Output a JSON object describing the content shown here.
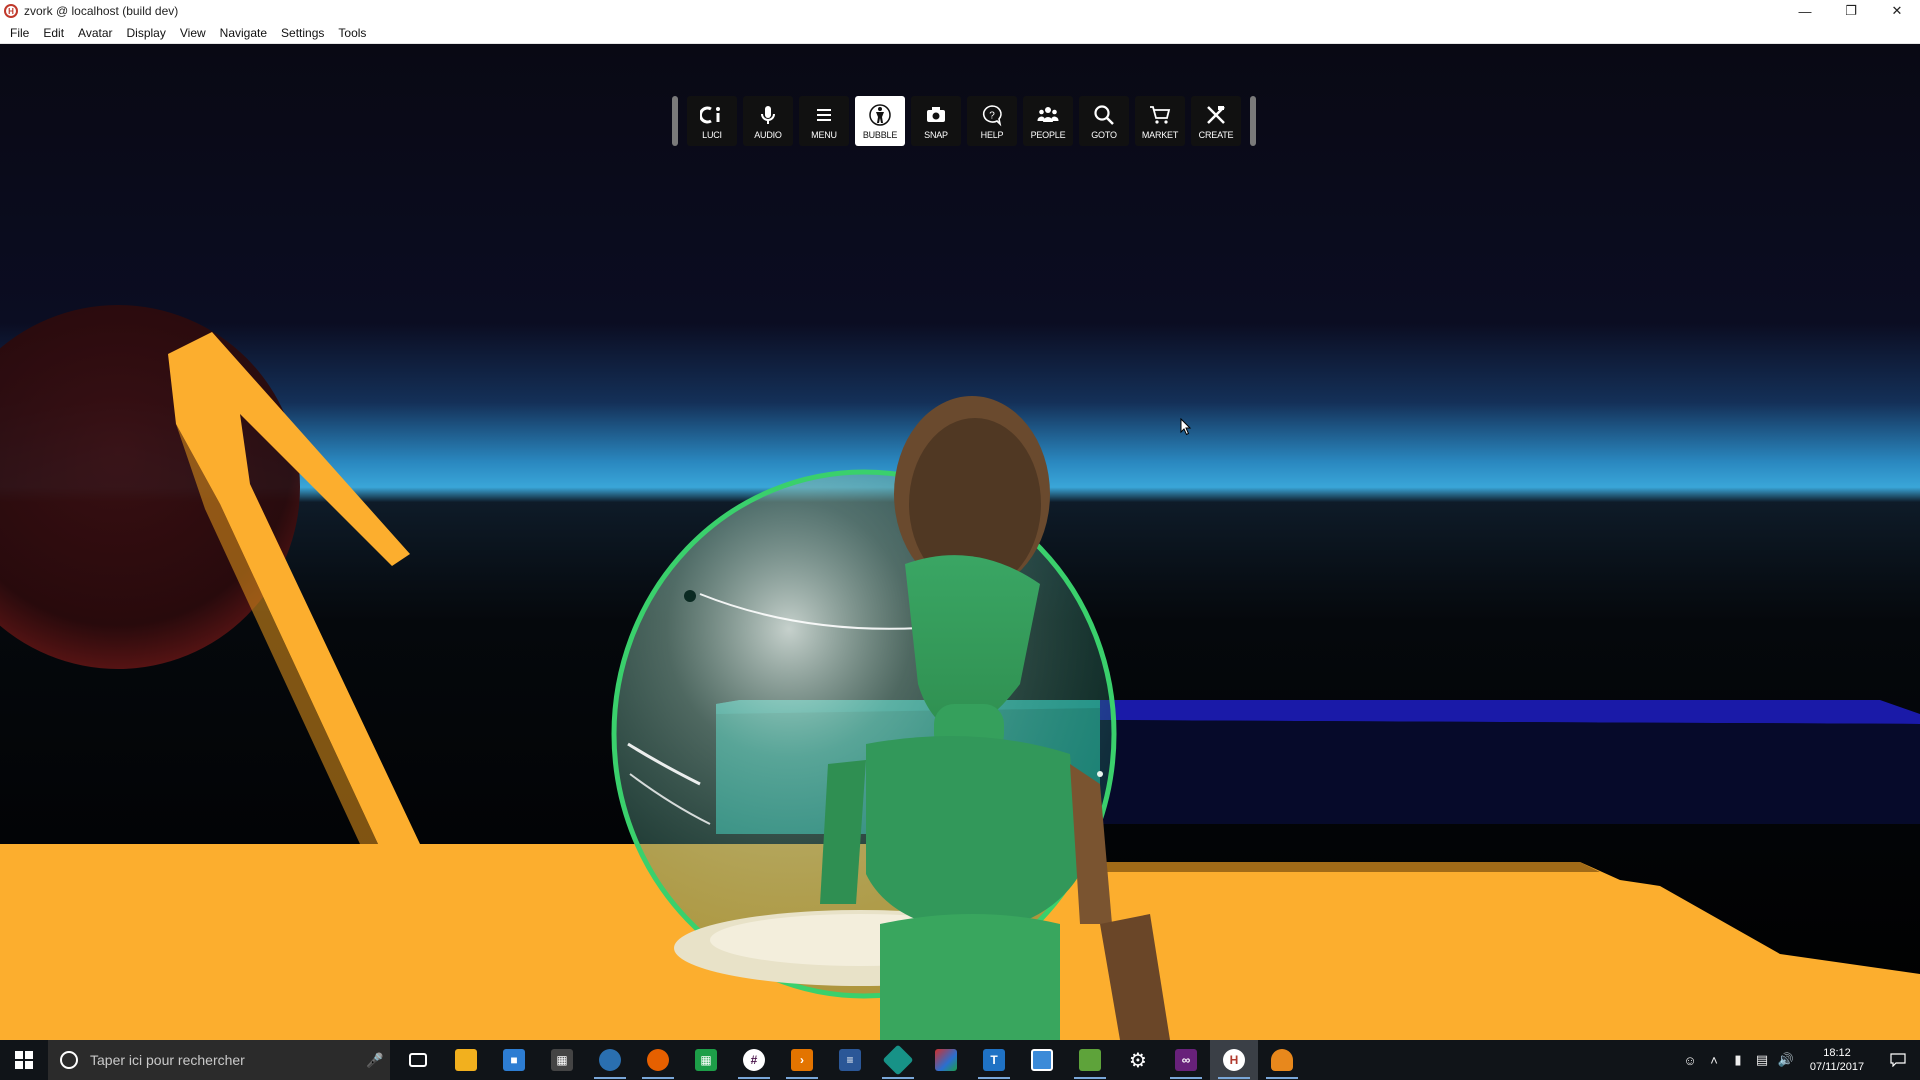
{
  "window": {
    "title": "zvork @ localhost (build dev)",
    "app_icon": "hifi-icon",
    "controls": [
      "minimize-icon",
      "restore-icon",
      "close-icon"
    ]
  },
  "menubar": {
    "items": [
      "File",
      "Edit",
      "Avatar",
      "Display",
      "View",
      "Navigate",
      "Settings",
      "Tools"
    ]
  },
  "toolbar": {
    "buttons": [
      {
        "label": "LUCI",
        "icon": "luci-icon",
        "active": false
      },
      {
        "label": "AUDIO",
        "icon": "microphone-icon",
        "active": false
      },
      {
        "label": "MENU",
        "icon": "menu-icon",
        "active": false
      },
      {
        "label": "BUBBLE",
        "icon": "bubble-icon",
        "active": true
      },
      {
        "label": "SNAP",
        "icon": "camera-icon",
        "active": false
      },
      {
        "label": "HELP",
        "icon": "help-icon",
        "active": false
      },
      {
        "label": "PEOPLE",
        "icon": "people-icon",
        "active": false
      },
      {
        "label": "GOTO",
        "icon": "search-icon",
        "active": false
      },
      {
        "label": "MARKET",
        "icon": "cart-icon",
        "active": false
      },
      {
        "label": "CREATE",
        "icon": "create-icon",
        "active": false
      }
    ]
  },
  "taskbar": {
    "search_placeholder": "Taper ici pour rechercher",
    "apps": [
      {
        "name": "task-view-icon",
        "color": "#101418",
        "running": false
      },
      {
        "name": "file-explorer-icon",
        "color": "#f2b01e",
        "running": false
      },
      {
        "name": "store-icon",
        "color": "#2d7dd2",
        "running": false
      },
      {
        "name": "calculator-icon",
        "color": "#444444",
        "running": false
      },
      {
        "name": "thunderbird-icon",
        "color": "#2a6fb0",
        "running": true
      },
      {
        "name": "firefox-icon",
        "color": "#e66000",
        "running": true
      },
      {
        "name": "spreadsheet-icon",
        "color": "#1d9e48",
        "running": false
      },
      {
        "name": "slack-icon",
        "color": "#4a154b",
        "running": true
      },
      {
        "name": "vscode-icon",
        "color": "#e37400",
        "running": true
      },
      {
        "name": "document-icon",
        "color": "#2b5797",
        "running": false
      },
      {
        "name": "gitkraken-icon",
        "color": "#179287",
        "running": true
      },
      {
        "name": "paint-icon",
        "color": "#d0302c",
        "running": false
      },
      {
        "name": "ruler-icon",
        "color": "#1f72c4",
        "running": true
      },
      {
        "name": "window-icon",
        "color": "#3b8ad8",
        "running": false
      },
      {
        "name": "notepad-icon",
        "color": "#5ea33a",
        "running": true
      },
      {
        "name": "settings-icon",
        "color": "#101418",
        "running": false
      },
      {
        "name": "visual-studio-icon",
        "color": "#68217a",
        "running": true
      },
      {
        "name": "interface-icon",
        "color": "#b03a2e",
        "running": true,
        "active": true
      },
      {
        "name": "sandbox-icon",
        "color": "#e8881c",
        "running": true
      }
    ],
    "tray": [
      "people-icon",
      "chevron-up-icon",
      "battery-icon",
      "network-icon",
      "volume-icon"
    ],
    "time": "18:12",
    "date": "07/11/2017"
  }
}
